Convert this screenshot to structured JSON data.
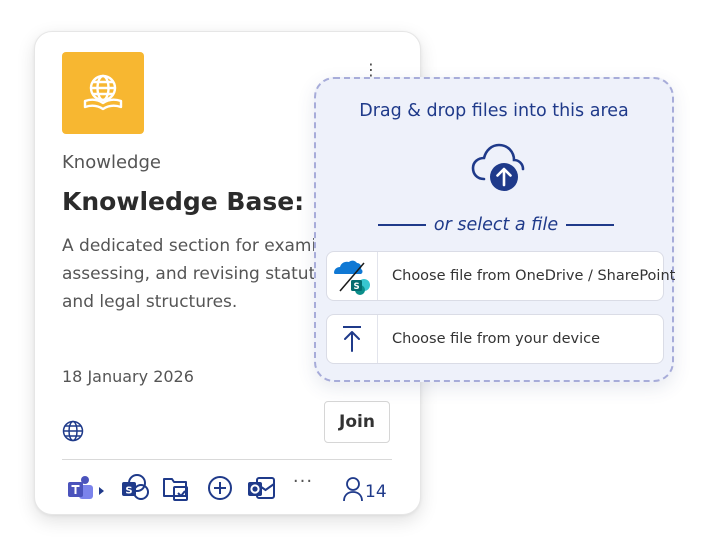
{
  "card": {
    "category": "Knowledge",
    "title": "Knowledge Base: Res",
    "description": "A dedicated section for exami\nassessing, and revising statuto\nand legal structures.",
    "date": "18 January 2026",
    "join_label": "Join",
    "more_label": "···",
    "member_count": "14",
    "icon_bg": "#f7b731"
  },
  "apps": [
    "teams-icon",
    "sharepoint-icon",
    "files-icon",
    "planner-icon",
    "outlook-icon"
  ],
  "dropzone": {
    "heading": "Drag & drop files into this area",
    "or_select": "or select a file",
    "options": [
      {
        "label": "Choose file from OneDrive / SharePoint",
        "icon": "onedrive-sharepoint-icon"
      },
      {
        "label": "Choose file from your device",
        "icon": "upload-icon"
      }
    ],
    "accent": "#1f3a8a"
  }
}
